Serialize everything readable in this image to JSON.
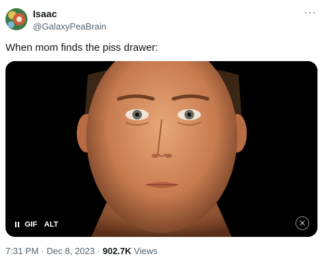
{
  "user": {
    "name": "Isaac",
    "handle": "@GalaxyPeaBrain"
  },
  "more_icon": "more-horizontal-icon",
  "tweet": {
    "text": "When mom finds the piss drawer:"
  },
  "media": {
    "controls": {
      "pause": "pause-icon",
      "gif_label": "GIF",
      "alt_label": "ALT"
    },
    "badge_icon": "xbox-logo-icon"
  },
  "meta": {
    "time": "7:31 PM",
    "sep1": "·",
    "date": "Dec 8, 2023",
    "sep2": "·",
    "views_count": "902.7K",
    "views_label": "Views"
  },
  "colors": {
    "text": "#0f1419",
    "secondary": "#536471",
    "media_bg": "#000000"
  }
}
